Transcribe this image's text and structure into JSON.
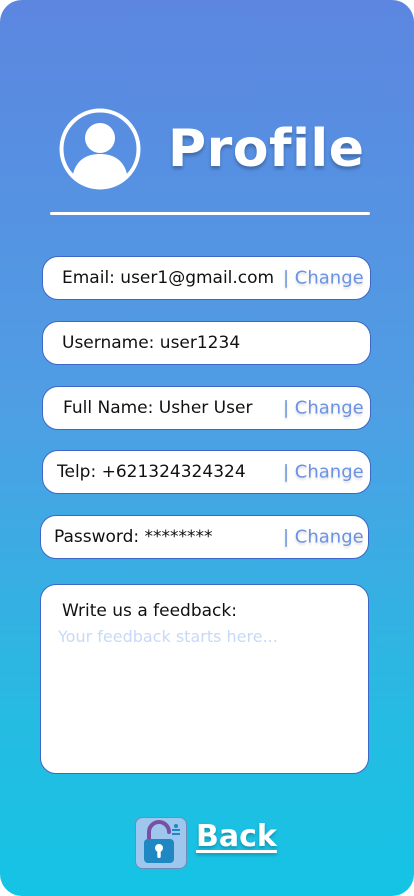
{
  "header": {
    "title": "Profile",
    "avatar_icon": "user-avatar-icon"
  },
  "fields": {
    "email": {
      "label": "Email: user1@gmail.com",
      "action": "| Change"
    },
    "username": {
      "label": "Username: user1234"
    },
    "fullname": {
      "label": "Full Name: Usher User",
      "action": "| Change"
    },
    "telp": {
      "label": "Telp: +621324324324",
      "action": "| Change"
    },
    "password": {
      "label": "Password: ********",
      "action": "| Change"
    }
  },
  "feedback": {
    "label": "Write us a feedback:",
    "placeholder": "Your feedback starts here..."
  },
  "footer": {
    "back_label": "Back",
    "icon": "lock-icon"
  },
  "colors": {
    "accent": "#6b93e3",
    "border": "#3e66c8",
    "gradient_top": "#5c86e0",
    "gradient_bottom": "#14c4e4"
  }
}
